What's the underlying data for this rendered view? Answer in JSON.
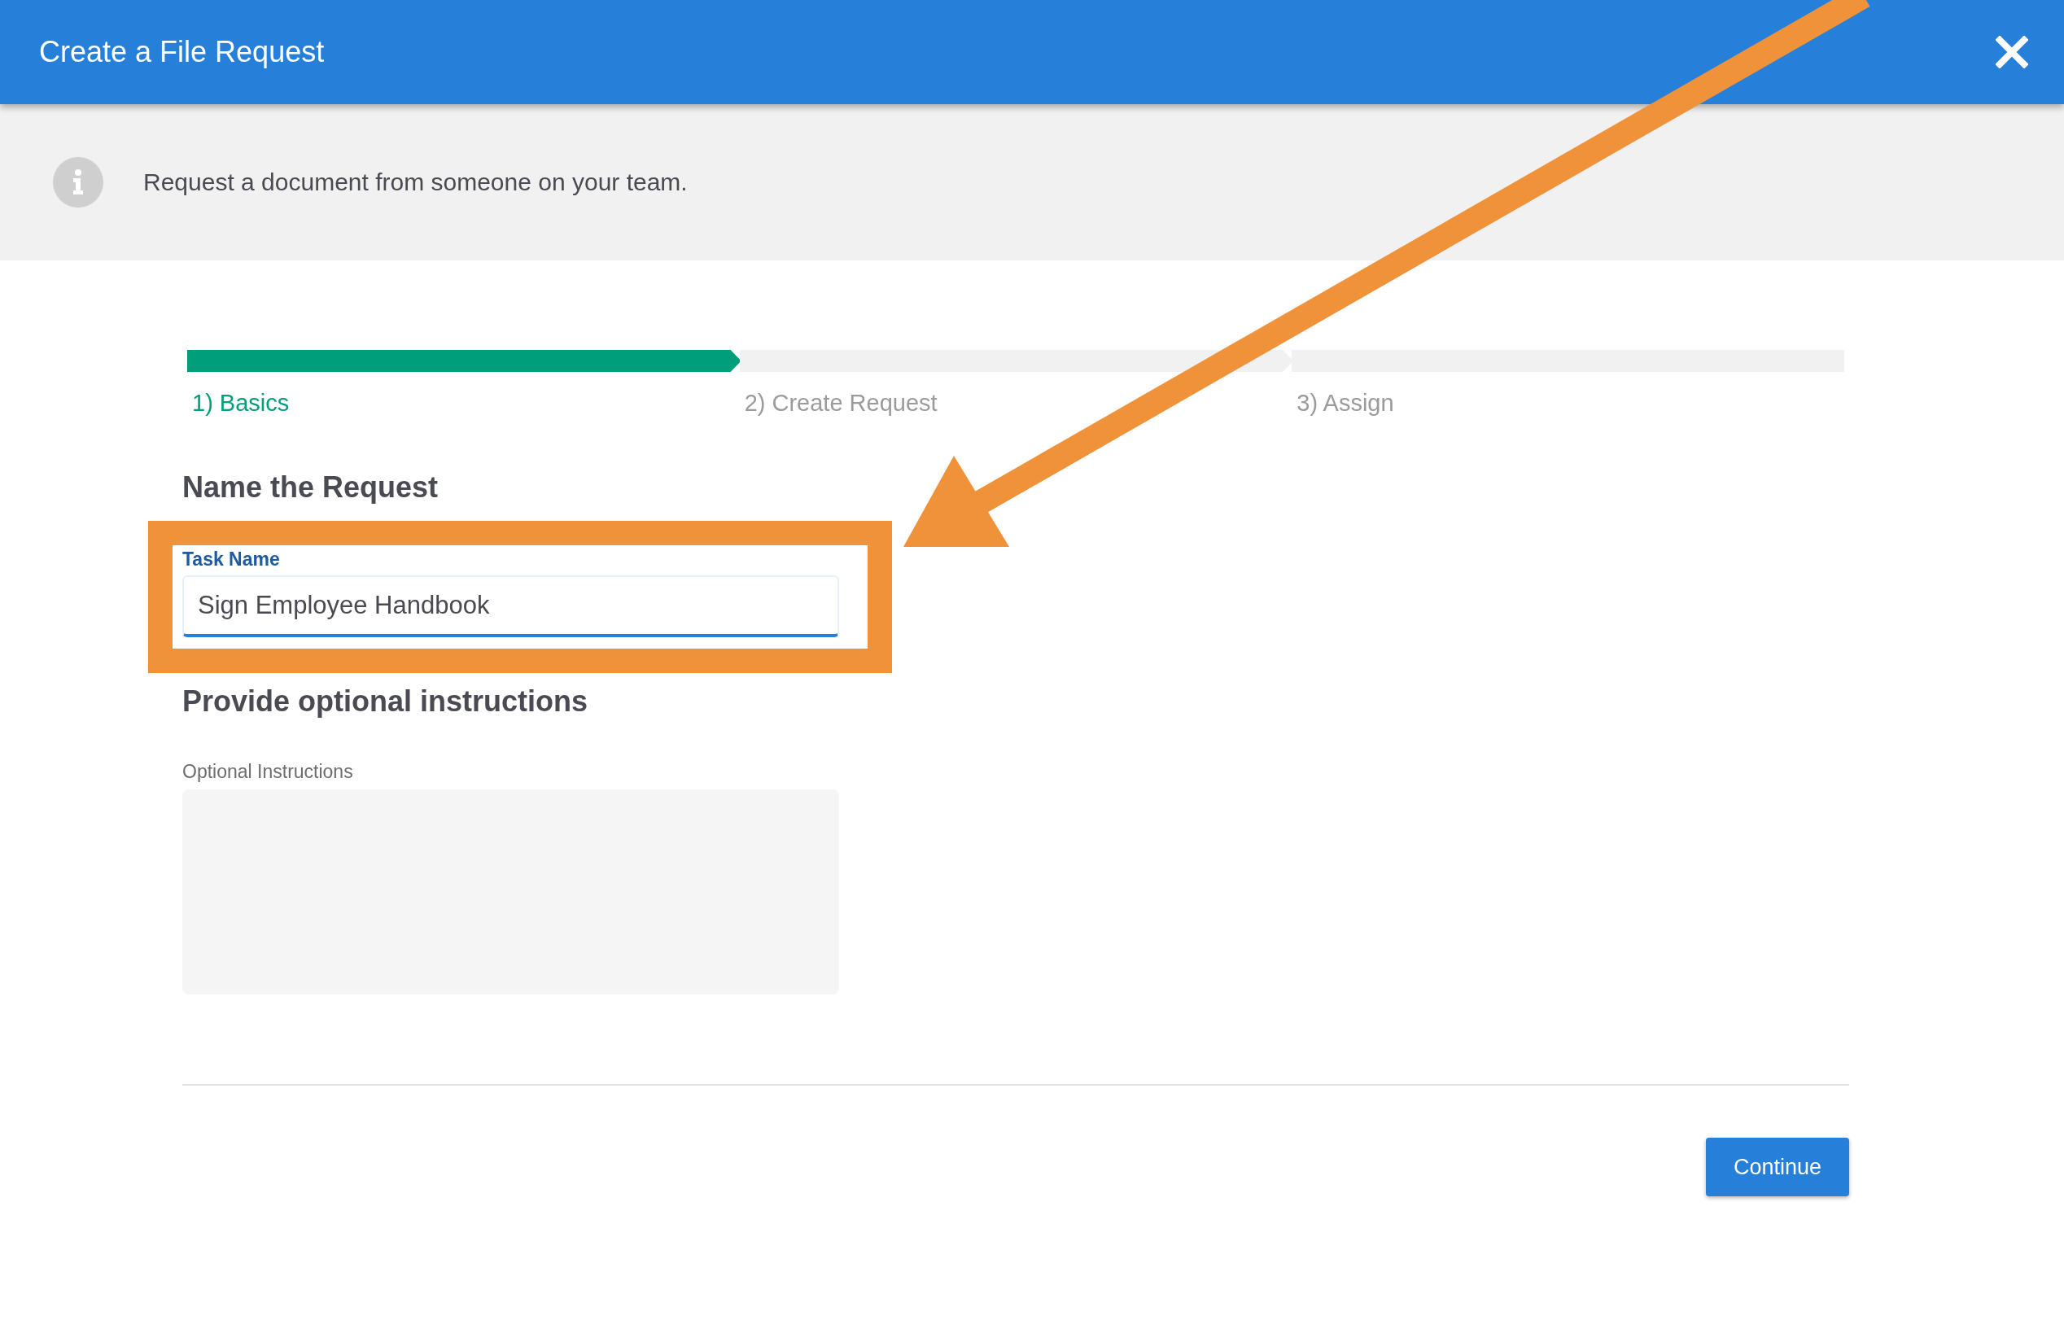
{
  "dialog": {
    "title": "Create a File Request"
  },
  "info_banner": {
    "text": "Request a document from someone on your team."
  },
  "steps": [
    {
      "label": "1) Basics",
      "selected": true
    },
    {
      "label": "2) Create Request",
      "selected": false
    },
    {
      "label": "3) Assign",
      "selected": false
    }
  ],
  "name_section": {
    "heading": "Name the Request",
    "field": {
      "label": "Task Name",
      "value": "Sign Employee Handbook",
      "focused": true
    }
  },
  "instructions_section": {
    "heading": "Provide optional instructions",
    "field": {
      "label": "Optional Instructions",
      "focused": false
    }
  },
  "continue_button": {
    "label": "Continue"
  }
}
